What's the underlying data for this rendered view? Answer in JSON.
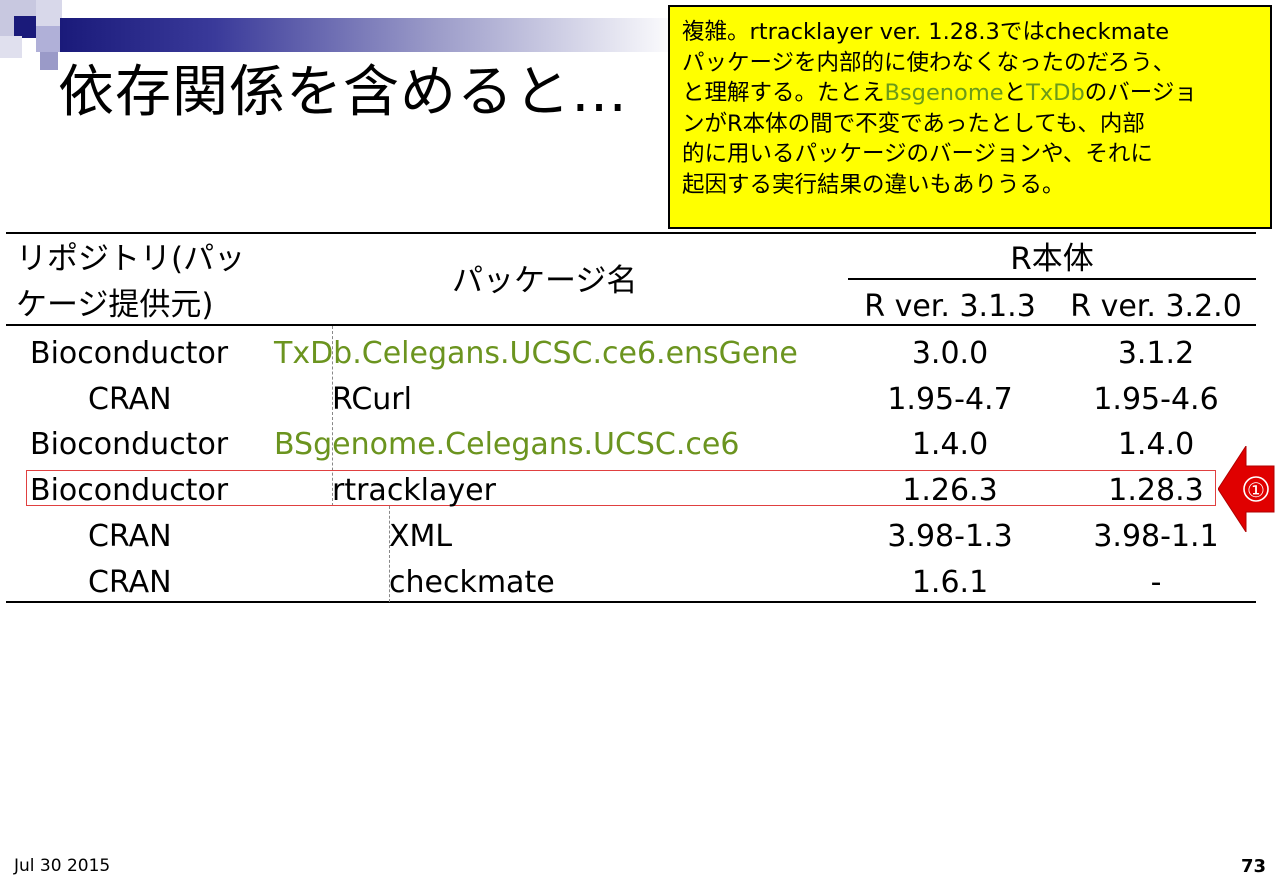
{
  "slide": {
    "title": "依存関係を含めると…",
    "date": "Jul 30 2015",
    "page_number": "73"
  },
  "note": {
    "line1": "複雑。rtracklayer ver. 1.28.3ではcheckmate",
    "line2": "パッケージを内部的に使わなくなったのだろう、",
    "line3_a": "と理解する。たとえ",
    "line3_b": "Bsgenome",
    "line3_c": "と",
    "line3_d": "TxDb",
    "line3_e": "のバージョ",
    "line4": "ンがR本体の間で不変であったとしても、内部",
    "line5": "的に用いるパッケージのバージョンや、それに",
    "line6": "起因する実行結果の違いもありうる。"
  },
  "table": {
    "header_repo_line1": "リポジトリ(パッ",
    "header_repo_line2": "ケージ提供元)",
    "header_package": "パッケージ名",
    "header_r": "R本体",
    "header_v1": "R ver. 3.1.3",
    "header_v2": "R ver. 3.2.0",
    "rows": [
      {
        "repo": "Bioconductor",
        "package": "TxDb.Celegans.UCSC.ce6.ensGene",
        "v1": "3.0.0",
        "v2": "3.1.2"
      },
      {
        "repo": "CRAN",
        "package": "RCurl",
        "v1": "1.95-4.7",
        "v2": "1.95-4.6"
      },
      {
        "repo": "Bioconductor",
        "package": "BSgenome.Celegans.UCSC.ce6",
        "v1": "1.4.0",
        "v2": "1.4.0"
      },
      {
        "repo": "Bioconductor",
        "package": "rtracklayer",
        "v1": "1.26.3",
        "v2": "1.28.3"
      },
      {
        "repo": "CRAN",
        "package": "XML",
        "v1": "3.98-1.3",
        "v2": "3.98-1.1"
      },
      {
        "repo": "CRAN",
        "package": "checkmate",
        "v1": "1.6.1",
        "v2": "-"
      }
    ]
  },
  "marker": {
    "label": "①",
    "color": "#e00000"
  },
  "colors": {
    "note_bg": "#ffff00",
    "green": "#6b941f",
    "highlight": "#e04040"
  }
}
